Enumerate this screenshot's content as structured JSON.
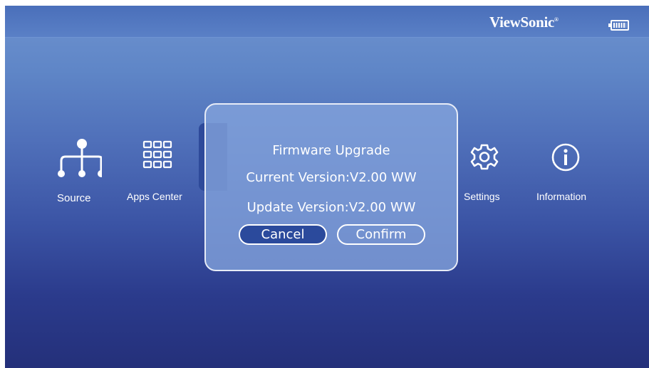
{
  "header": {
    "brand": "ViewSonic",
    "brand_mark": "®",
    "battery_icon": "battery-full-icon"
  },
  "menu": {
    "items": [
      {
        "id": "source",
        "label": "Source",
        "icon": "source-tree-icon"
      },
      {
        "id": "apps-center",
        "label": "Apps Center",
        "icon": "apps-grid-icon"
      },
      {
        "id": "settings",
        "label": "Settings",
        "icon": "gear-icon"
      },
      {
        "id": "information",
        "label": "Information",
        "icon": "info-icon"
      }
    ]
  },
  "dialog": {
    "title": "Firmware Upgrade",
    "current_version": "Current Version:V2.00 WW",
    "update_version": "Update Version:V2.00 WW",
    "cancel_label": "Cancel",
    "confirm_label": "Confirm"
  },
  "colors": {
    "background_top": "#6e92cf",
    "background_bottom": "#24307a",
    "selected_button": "#2b4a9c",
    "text": "#ffffff"
  }
}
